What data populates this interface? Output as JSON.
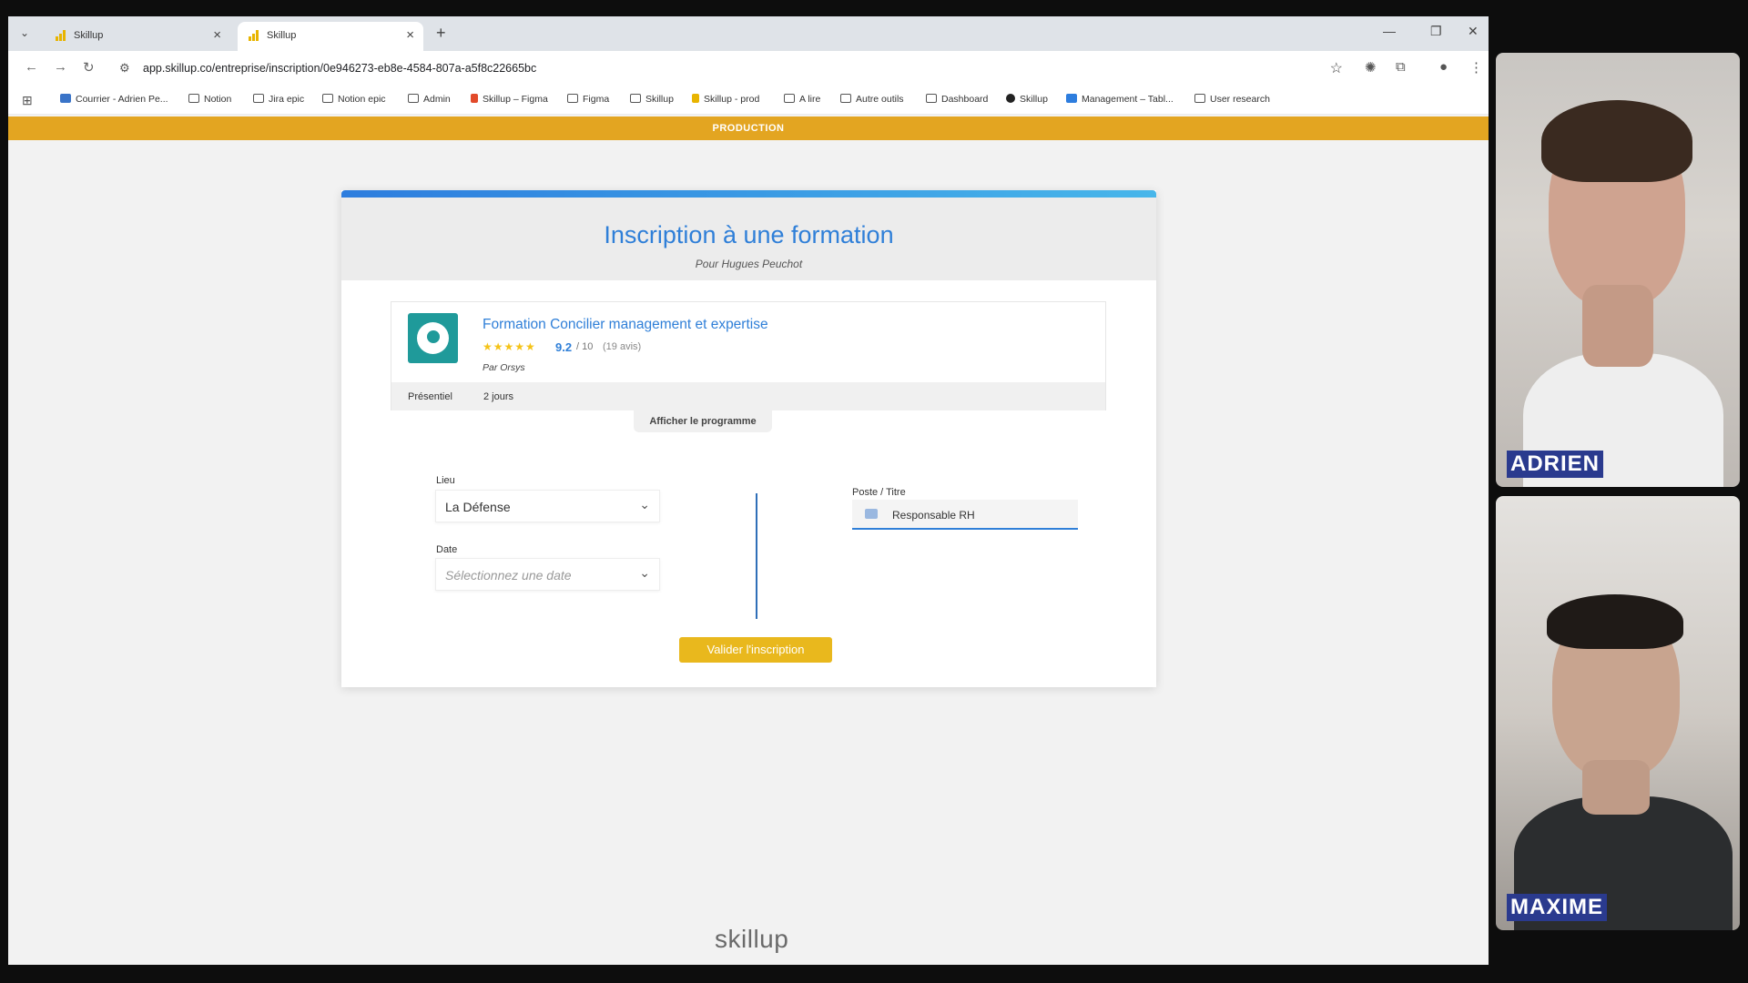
{
  "browser": {
    "tabs": [
      {
        "title": "Skillup",
        "active": false
      },
      {
        "title": "Skillup",
        "active": true
      }
    ],
    "url": "app.skillup.co/entreprise/inscription/0e946273-eb8e-4584-807a-a5f8c22665bc",
    "bookmarks": [
      "Courrier - Adrien Pe...",
      "Notion",
      "Jira epic",
      "Notion epic",
      "Admin",
      "Skillup – Figma",
      "Figma",
      "Skillup",
      "Skillup - prod",
      "A lire",
      "Autre outils",
      "Dashboard",
      "Skillup",
      "Management – Tabl...",
      "User research"
    ]
  },
  "env_banner": "PRODUCTION",
  "page": {
    "title": "Inscription à une formation",
    "subtitle": "Pour Hugues Peuchot",
    "course": {
      "name": "Formation Concilier management et expertise",
      "rating": "9.2",
      "rating_max": "/ 10",
      "rating_fraction": 0.92,
      "reviews": "(19 avis)",
      "provider": "Par Orsys",
      "mode": "Présentiel",
      "duration": "2 jours"
    },
    "program_button": "Afficher le programme",
    "form": {
      "lieu_label": "Lieu",
      "lieu_value": "La Défense",
      "date_label": "Date",
      "date_placeholder": "Sélectionnez une date",
      "poste_label": "Poste / Titre",
      "poste_value": "Responsable RH"
    },
    "submit_button": "Valider l'inscription",
    "footer_brand": "skillup"
  },
  "participants": [
    {
      "name": "ADRIEN"
    },
    {
      "name": "MAXIME"
    }
  ],
  "colors": {
    "accent_blue": "#2f7fd8",
    "production_banner": "#e3a521",
    "submit_button": "#e9b81d",
    "name_tag": "#2a3a8e"
  }
}
